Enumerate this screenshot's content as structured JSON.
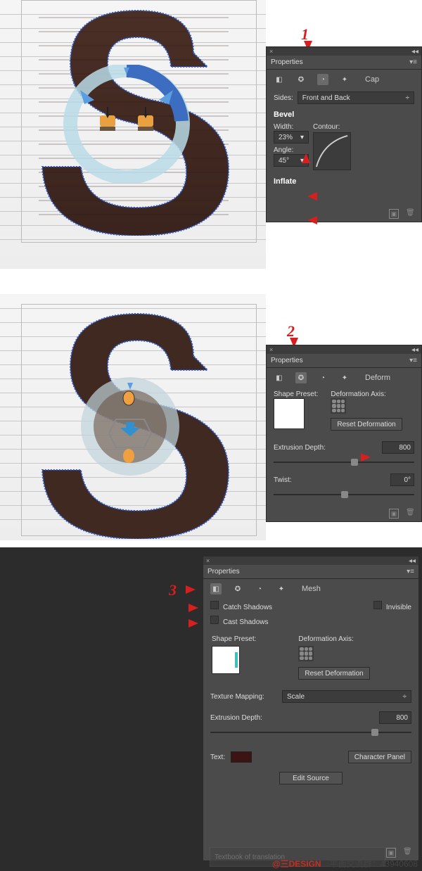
{
  "steps": {
    "s1": "1",
    "s2": "2",
    "s3": "3"
  },
  "panel1": {
    "title": "Properties",
    "mode": "Cap",
    "sides_label": "Sides:",
    "sides_value": "Front and Back",
    "bevel_heading": "Bevel",
    "width_label": "Width:",
    "width_value": "23%",
    "angle_label": "Angle:",
    "angle_value": "45°",
    "contour_label": "Contour:",
    "inflate_heading": "Inflate"
  },
  "panel2": {
    "title": "Properties",
    "mode": "Deform",
    "shape_preset_label": "Shape Preset:",
    "deform_axis_label": "Deformation Axis:",
    "reset_btn": "Reset Deformation",
    "extrusion_label": "Extrusion Depth:",
    "extrusion_value": "800",
    "twist_label": "Twist:",
    "twist_value": "0°"
  },
  "panel3": {
    "title": "Properties",
    "mode": "Mesh",
    "catch_label": "Catch Shadows",
    "cast_label": "Cast Shadows",
    "invisible_label": "Invisible",
    "shape_preset_label": "Shape Preset:",
    "deform_axis_label": "Deformation Axis:",
    "reset_btn": "Reset Deformation",
    "texture_label": "Texture Mapping:",
    "texture_value": "Scale",
    "extrusion_label": "Extrusion Depth:",
    "extrusion_value": "800",
    "text_label": "Text:",
    "char_panel_btn": "Character Panel",
    "edit_src_btn": "Edit Source"
  },
  "footer": {
    "logo": "@三DESIGN",
    "group_label": "平面交流群：",
    "group_num": "43940608",
    "ghost": "Textbook of translation"
  }
}
